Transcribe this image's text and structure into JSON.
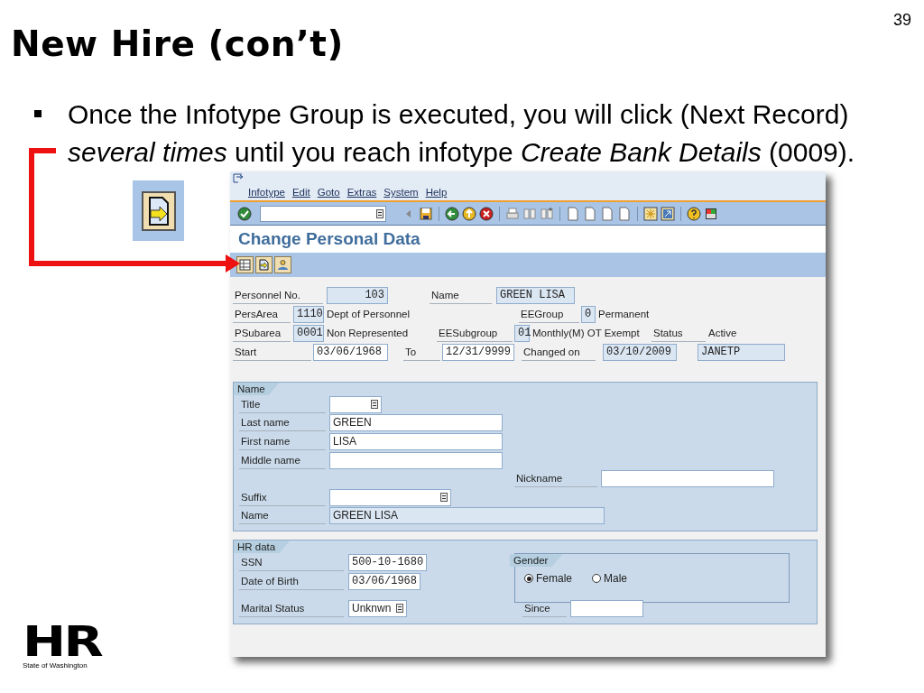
{
  "slide": {
    "page_number": "39",
    "title": "New Hire (con’t)",
    "bullet": "Once the Infotype Group is executed, you will click (Next Record) *several times* until you reach infotype *Create Bank Details* (0009)."
  },
  "menu": [
    "Infotype",
    "Edit",
    "Goto",
    "Extras",
    "System",
    "Help"
  ],
  "screen_title": "Change Personal Data",
  "header_rows": [
    [
      {
        "kind": "label",
        "text": "Personnel No."
      },
      {
        "kind": "number",
        "text": "103"
      },
      {
        "kind": "label",
        "text": "Name"
      },
      {
        "kind": "output",
        "text": "GREEN LISA"
      }
    ],
    [
      {
        "kind": "label",
        "text": "PersArea"
      },
      {
        "kind": "output",
        "text": "1110"
      },
      {
        "kind": "text",
        "text": "Dept of Personnel"
      },
      {
        "kind": "label",
        "text": "EEGroup"
      },
      {
        "kind": "output",
        "text": "0"
      },
      {
        "kind": "text",
        "text": "Permanent"
      }
    ],
    [
      {
        "kind": "label",
        "text": "PSubarea"
      },
      {
        "kind": "output",
        "text": "0001"
      },
      {
        "kind": "text",
        "text": "Non Represented"
      },
      {
        "kind": "label",
        "text": "EESubgroup"
      },
      {
        "kind": "output",
        "text": "01"
      },
      {
        "kind": "text",
        "text": "Monthly(M) OT Exempt"
      },
      {
        "kind": "label",
        "text": "Status"
      },
      {
        "kind": "text",
        "text": "Active"
      }
    ],
    [
      {
        "kind": "label",
        "text": "Start"
      },
      {
        "kind": "input",
        "text": "03/06/1968"
      },
      {
        "kind": "label",
        "text": "To"
      },
      {
        "kind": "input",
        "text": "12/31/9999"
      },
      {
        "kind": "label",
        "text": "Changed on"
      },
      {
        "kind": "output",
        "text": "03/10/2009"
      },
      {
        "kind": "output",
        "text": "JANETP"
      }
    ]
  ],
  "name_group": {
    "title": "Name",
    "rows": [
      {
        "left": {
          "label": "Title",
          "kind": "dropdown"
        }
      },
      {
        "left": {
          "label": "Last name",
          "kind": "input",
          "value": "GREEN"
        }
      },
      {
        "left": {
          "label": "First name",
          "kind": "input",
          "value": "LISA"
        }
      },
      {
        "left": {
          "label": "Middle name",
          "kind": "input"
        }
      },
      {
        "right": {
          "label": "Nickname",
          "kind": "input"
        }
      },
      {
        "left": {
          "label": "Suffix",
          "kind": "dropdown"
        }
      },
      {
        "left": {
          "label": "Name",
          "kind": "output",
          "value": "GREEN LISA"
        }
      }
    ]
  },
  "hr_group": {
    "title": "HR data",
    "fields": [
      {
        "label": "SSN",
        "kind": "input",
        "value": "500-10-1680"
      },
      {
        "label": "Date of Birth",
        "kind": "input",
        "value": "03/06/1968"
      }
    ],
    "marital": {
      "label": "Marital Status",
      "value": "Unknwn"
    },
    "gender": {
      "title": "Gender",
      "options": [
        {
          "label": "Female",
          "selected": true
        },
        {
          "label": "Male",
          "selected": false
        }
      ]
    },
    "since": {
      "label": "Since"
    }
  },
  "logo": {
    "mark": "HR",
    "caption": "State of Washington"
  }
}
